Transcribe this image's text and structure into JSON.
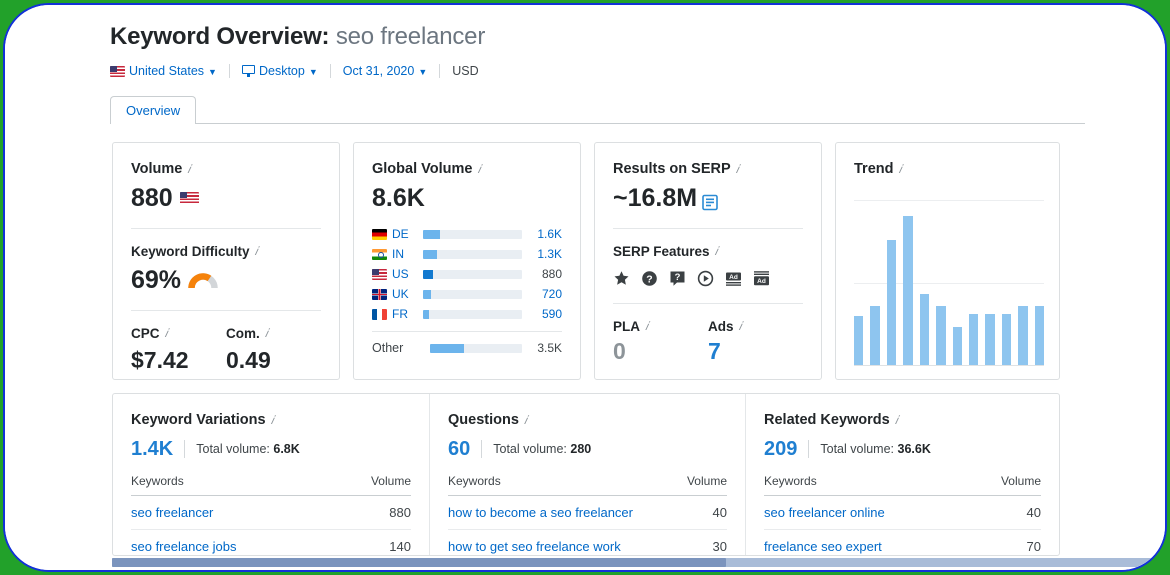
{
  "header": {
    "title_prefix": "Keyword Overview:",
    "keyword": "seo freelancer",
    "filters": {
      "country": "United States",
      "device": "Desktop",
      "date": "Oct 31, 2020",
      "currency": "USD"
    }
  },
  "tabs": [
    {
      "label": "Overview",
      "active": true
    }
  ],
  "volume_card": {
    "title": "Volume",
    "value": "880",
    "difficulty_title": "Keyword Difficulty",
    "difficulty_value": "69%",
    "difficulty_percent": 69,
    "difficulty_color": "#f5820b",
    "cpc_label": "CPC",
    "cpc_value": "$7.42",
    "com_label": "Com.",
    "com_value": "0.49"
  },
  "global_card": {
    "title": "Global Volume",
    "value": "8.6K",
    "rows": [
      {
        "flag": "de",
        "code": "DE",
        "volume": "1.6K",
        "pct": 17,
        "current": false
      },
      {
        "flag": "in",
        "code": "IN",
        "volume": "1.3K",
        "pct": 14,
        "current": false
      },
      {
        "flag": "us",
        "code": "US",
        "volume": "880",
        "pct": 10,
        "current": true
      },
      {
        "flag": "uk",
        "code": "UK",
        "volume": "720",
        "pct": 8,
        "current": false
      },
      {
        "flag": "fr",
        "code": "FR",
        "volume": "590",
        "pct": 6,
        "current": false
      }
    ],
    "other": {
      "code": "Other",
      "volume": "3.5K",
      "pct": 37
    }
  },
  "serp_card": {
    "results_title": "Results on SERP",
    "results_value": "~16.8M",
    "features_title": "SERP Features",
    "features": [
      "reviews-star-icon",
      "faq-circle-icon",
      "people-also-ask-icon",
      "video-play-icon",
      "ads-bottom-icon",
      "ads-top-icon"
    ],
    "pla_label": "PLA",
    "pla_value": "0",
    "ads_label": "Ads",
    "ads_value": "7"
  },
  "trend_card": {
    "title": "Trend"
  },
  "chart_data": {
    "type": "bar",
    "title": "Trend",
    "xlabel": "",
    "ylabel": "",
    "grid": true,
    "gridlines_y": [
      0.5,
      1.0
    ],
    "categories": [
      "1",
      "2",
      "3",
      "4",
      "5",
      "6",
      "7",
      "8",
      "9",
      "10",
      "11",
      "12"
    ],
    "values": [
      0.3,
      0.36,
      0.76,
      0.91,
      0.43,
      0.36,
      0.23,
      0.31,
      0.31,
      0.31,
      0.36,
      0.36
    ],
    "ylim": [
      0,
      1
    ],
    "bar_color": "#8ec5ef"
  },
  "keyword_panels": [
    {
      "title": "Keyword Variations",
      "count": "1.4K",
      "total_label": "Total volume:",
      "total_value": "6.8K",
      "col_keyword": "Keywords",
      "col_volume": "Volume",
      "rows": [
        {
          "keyword": "seo freelancer",
          "volume": "880"
        },
        {
          "keyword": "seo freelance jobs",
          "volume": "140"
        }
      ]
    },
    {
      "title": "Questions",
      "count": "60",
      "total_label": "Total volume:",
      "total_value": "280",
      "col_keyword": "Keywords",
      "col_volume": "Volume",
      "rows": [
        {
          "keyword": "how to become a seo freelancer",
          "volume": "40"
        },
        {
          "keyword": "how to get seo freelance work",
          "volume": "30"
        }
      ]
    },
    {
      "title": "Related Keywords",
      "count": "209",
      "total_label": "Total volume:",
      "total_value": "36.6K",
      "col_keyword": "Keywords",
      "col_volume": "Volume",
      "rows": [
        {
          "keyword": "seo freelancer online",
          "volume": "40"
        },
        {
          "keyword": "freelance seo expert",
          "volume": "70"
        }
      ]
    }
  ]
}
